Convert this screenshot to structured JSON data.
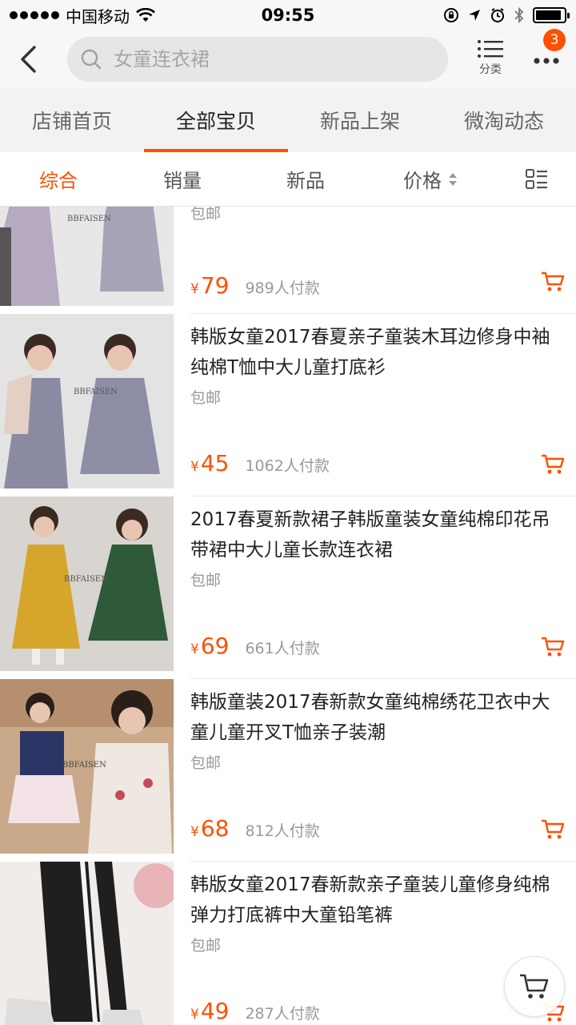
{
  "status_bar": {
    "carrier": "中国移动",
    "time": "09:55"
  },
  "nav": {
    "search_placeholder": "女童连衣裙",
    "category_label": "分类",
    "badge_count": "3"
  },
  "shop_tabs": [
    {
      "label": "店铺首页",
      "active": false
    },
    {
      "label": "全部宝贝",
      "active": true
    },
    {
      "label": "新品上架",
      "active": false
    },
    {
      "label": "微淘动态",
      "active": false
    }
  ],
  "sort_bar": {
    "items": [
      {
        "label": "综合",
        "active": true
      },
      {
        "label": "销量",
        "active": false
      },
      {
        "label": "新品",
        "active": false
      },
      {
        "label": "价格",
        "active": false
      }
    ]
  },
  "colors": {
    "accent": "#ff5000",
    "text_primary": "#222222",
    "text_secondary": "#999999"
  },
  "products": [
    {
      "title": "",
      "shipping": "包邮",
      "currency": "¥",
      "price": "79",
      "sold": "989人付款",
      "image_text": "BBFAISEN"
    },
    {
      "title": "韩版女童2017春夏亲子童装木耳边修身中袖纯棉T恤中大儿童打底衫",
      "shipping": "包邮",
      "currency": "¥",
      "price": "45",
      "sold": "1062人付款",
      "image_text": "BBFAISEN"
    },
    {
      "title": "2017春夏新款裙子韩版童装女童纯棉印花吊带裙中大儿童长款连衣裙",
      "shipping": "包邮",
      "currency": "¥",
      "price": "69",
      "sold": "661人付款",
      "image_text": "BBFAISEN"
    },
    {
      "title": "韩版童装2017春新款女童纯棉绣花卫衣中大童儿童开叉T恤亲子装潮",
      "shipping": "包邮",
      "currency": "¥",
      "price": "68",
      "sold": "812人付款",
      "image_text": "BBFAISEN"
    },
    {
      "title": "韩版女童2017春新款亲子童装儿童修身纯棉弹力打底裤中大童铅笔裤",
      "shipping": "包邮",
      "currency": "¥",
      "price": "49",
      "sold": "287人付款",
      "image_text": ""
    }
  ]
}
